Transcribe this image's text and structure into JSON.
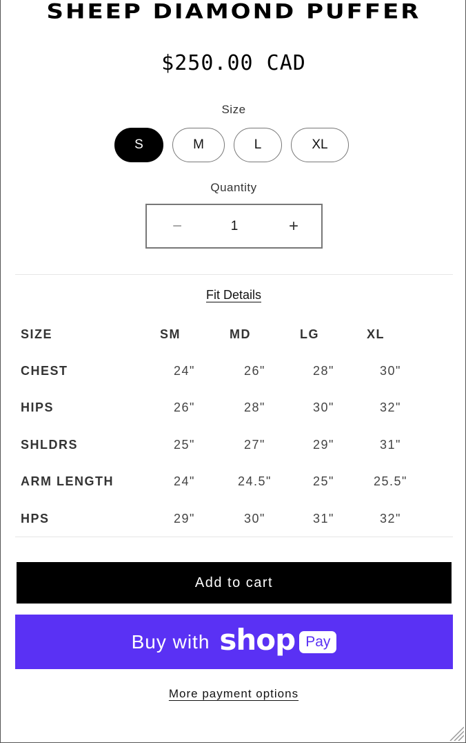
{
  "product": {
    "title": "SHEEP DIAMOND PUFFER",
    "price": "$250.00 CAD"
  },
  "size_picker": {
    "label": "Size",
    "options": [
      "S",
      "M",
      "L",
      "XL"
    ],
    "selected": "S"
  },
  "quantity": {
    "label": "Quantity",
    "minus": "−",
    "value": "1",
    "plus": "+"
  },
  "fit_details": {
    "link_label": "Fit Details",
    "columns": [
      "SIZE",
      "SM",
      "MD",
      "LG",
      "XL"
    ],
    "rows": [
      {
        "label": "CHEST",
        "values": [
          "24\"",
          "26\"",
          "28\"",
          "30\""
        ]
      },
      {
        "label": "HIPS",
        "values": [
          "26\"",
          "28\"",
          "30\"",
          "32\""
        ]
      },
      {
        "label": "SHLDRS",
        "values": [
          "25\"",
          "27\"",
          "29\"",
          "31\""
        ]
      },
      {
        "label": "ARM LENGTH",
        "values": [
          "24\"",
          "24.5\"",
          "25\"",
          "25.5\""
        ]
      },
      {
        "label": "HPS",
        "values": [
          "29\"",
          "30\"",
          "31\"",
          "32\""
        ]
      }
    ]
  },
  "actions": {
    "add_to_cart": "Add to cart",
    "buy_prefix": "Buy with",
    "shop_logo": "shop",
    "shop_pay_badge": "Pay",
    "more_payment": "More payment options"
  },
  "colors": {
    "shop_pay_purple": "#5a31f4",
    "primary_black": "#000000"
  }
}
